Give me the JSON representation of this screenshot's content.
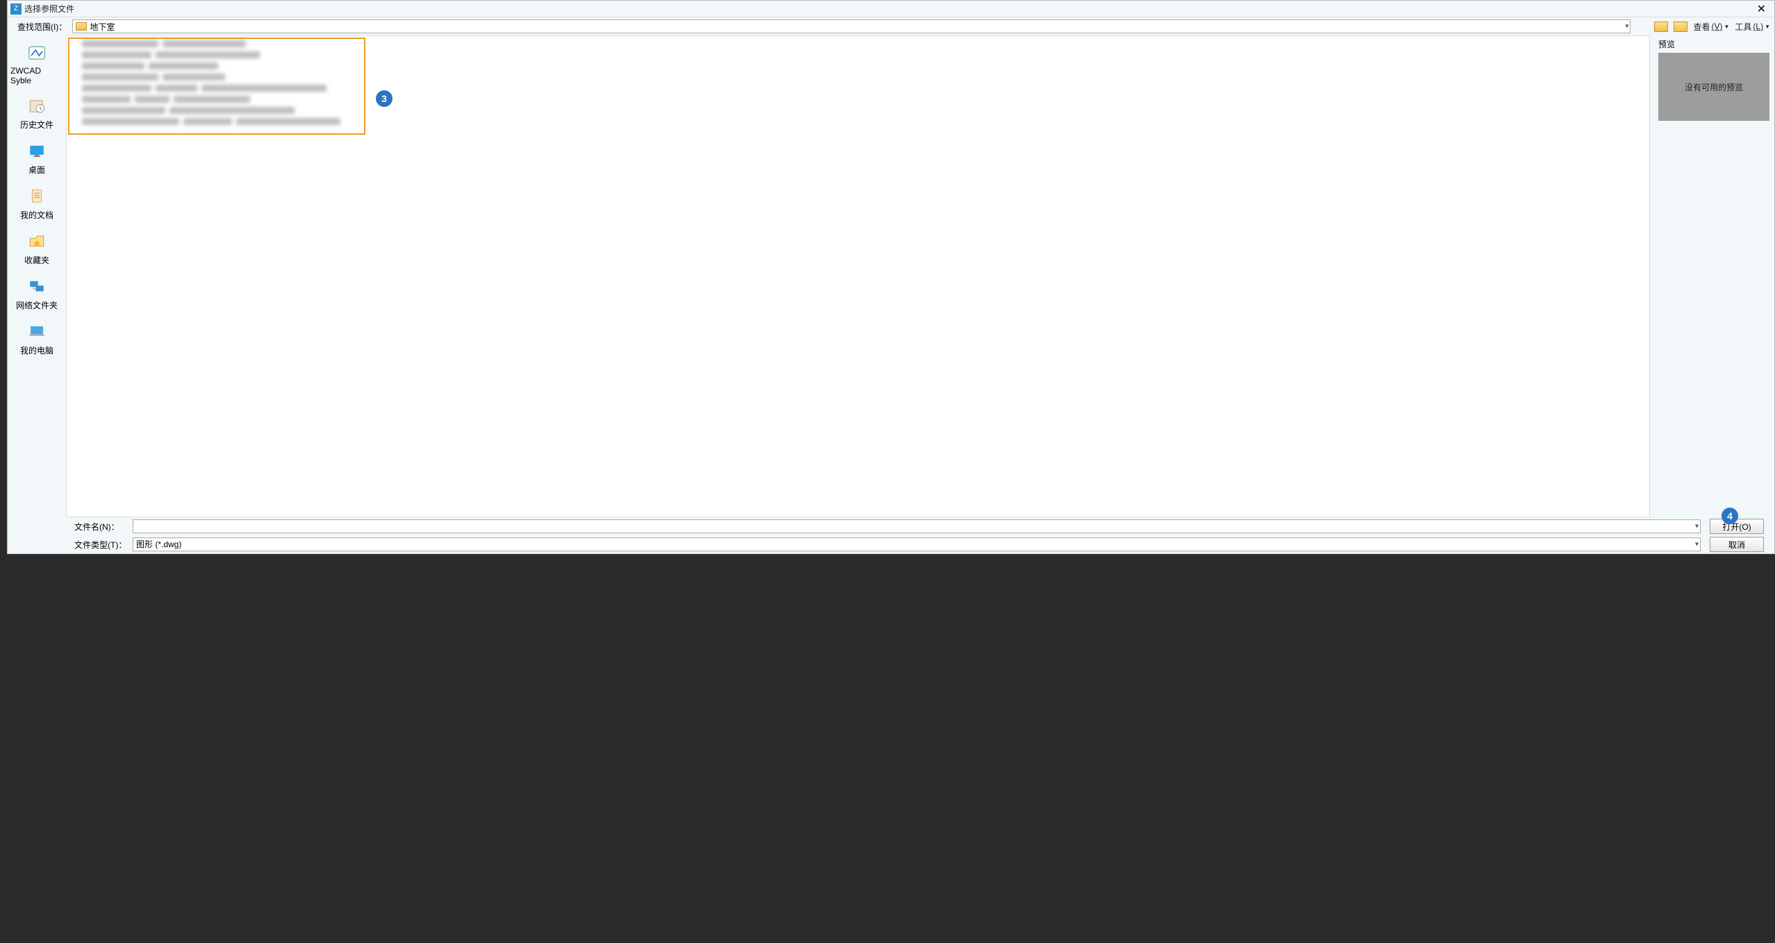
{
  "dialog": {
    "title": "选择参照文件",
    "close_tooltip": "关闭"
  },
  "toolbar": {
    "lookin_label": "查找范围(I)：",
    "location": "地下室",
    "view_menu": "查看",
    "view_hotkey": "(V)",
    "tools_menu": "工具",
    "tools_hotkey": "(L)"
  },
  "sidebar": {
    "items": [
      {
        "label": "ZWCAD Syble",
        "icon": "zwcad"
      },
      {
        "label": "历史文件",
        "icon": "history"
      },
      {
        "label": "桌面",
        "icon": "desktop"
      },
      {
        "label": "我的文档",
        "icon": "documents"
      },
      {
        "label": "收藏夹",
        "icon": "favorites"
      },
      {
        "label": "网络文件夹",
        "icon": "network"
      },
      {
        "label": "我的电脑",
        "icon": "computer"
      }
    ]
  },
  "preview": {
    "header": "预览",
    "empty_text": "没有可用的预览"
  },
  "bottom": {
    "filename_label": "文件名(N)：",
    "filename_value": "",
    "filetype_label": "文件类型(T)：",
    "filetype_value": "图形 (*.dwg)",
    "open_label": "打开(O)",
    "cancel_label": "取消"
  },
  "callouts": {
    "c3": "3",
    "c4": "4"
  }
}
